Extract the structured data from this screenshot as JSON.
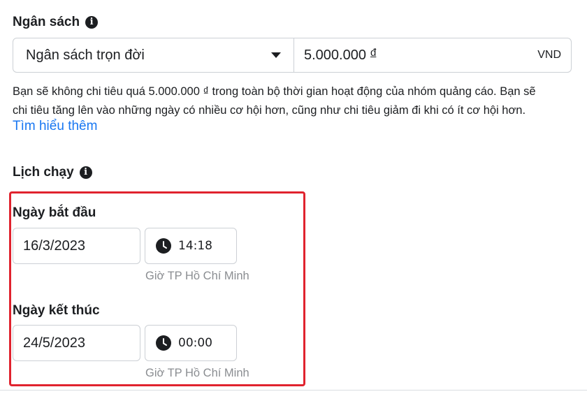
{
  "budget": {
    "title": "Ngân sách",
    "type_selected": "Ngân sách trọn đời",
    "amount": "5.000.000",
    "currency_symbol": "đ",
    "currency_code": "VND",
    "description_line1": "Bạn sẽ không chi tiêu quá 5.000.000 ₫ trong toàn bộ thời gian hoạt động của nhóm quảng cáo. Bạn sẽ",
    "description_line2": "chi tiêu tăng lên vào những ngày có nhiều cơ hội hơn, cũng như chi tiêu giảm đi khi có ít cơ hội hơn.",
    "learn_more": "Tìm hiểu thêm"
  },
  "schedule": {
    "title": "Lịch chạy",
    "start": {
      "label": "Ngày bắt đầu",
      "date": "16/3/2023",
      "time": "14:18",
      "timezone": "Giờ TP Hồ Chí Minh"
    },
    "end": {
      "label": "Ngày kết thúc",
      "date": "24/5/2023",
      "time": "00:00",
      "timezone": "Giờ TP Hồ Chí Minh"
    }
  },
  "icons": {
    "info": "info-icon",
    "clock": "clock-icon",
    "dropdown": "caret-down-icon"
  },
  "colors": {
    "link": "#1877f2",
    "highlight_border": "#e0232e",
    "muted_text": "#8a8d91"
  }
}
